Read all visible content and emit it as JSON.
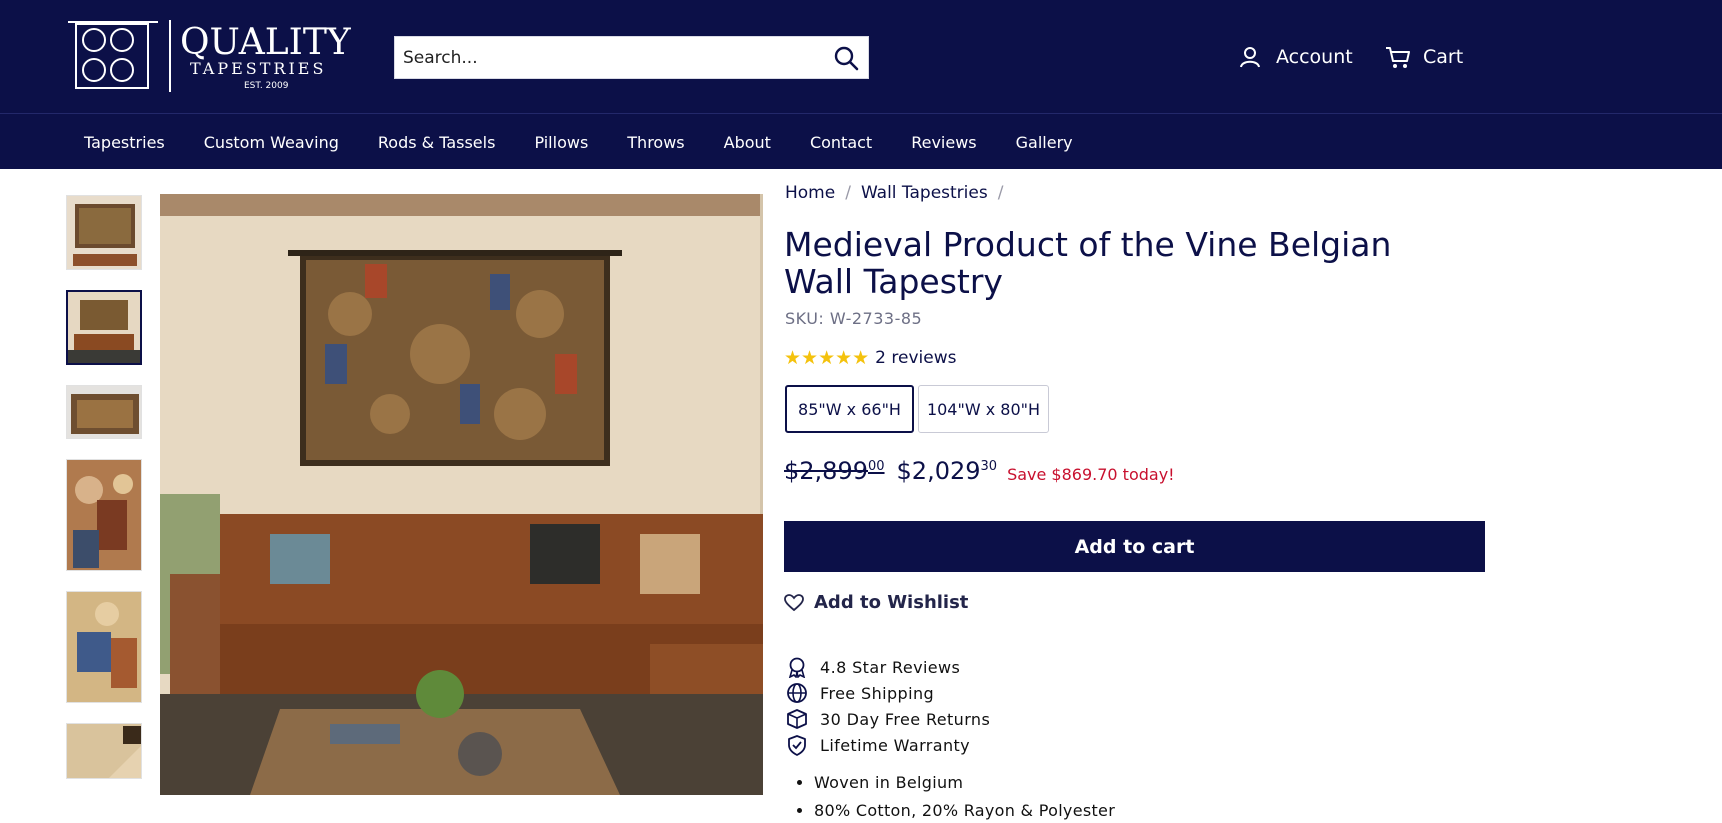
{
  "header": {
    "logo": {
      "name": "QUALITY",
      "sub": "TAPESTRIES",
      "est": "EST. 2009"
    },
    "search_placeholder": "Search...",
    "account_label": "Account",
    "cart_label": "Cart"
  },
  "nav": {
    "items": [
      "Tapestries",
      "Custom Weaving",
      "Rods & Tassels",
      "Pillows",
      "Throws",
      "About",
      "Contact",
      "Reviews",
      "Gallery"
    ]
  },
  "breadcrumb": {
    "home": "Home",
    "category": "Wall Tapestries"
  },
  "product": {
    "title": "Medieval Product of the Vine Belgian Wall Tapestry",
    "sku": "SKU: W-2733-85",
    "reviews_label": "2 reviews",
    "stars": "★★★★★",
    "variants": [
      "85\"W x 66\"H",
      "104\"W x 80\"H"
    ],
    "selected_variant": "85\"W x 66\"H",
    "old_price_main": "$2,899",
    "old_price_cents": "00",
    "price_main": "$2,029",
    "price_cents": "30",
    "save_text": "Save $869.70 today!",
    "add_to_cart": "Add to cart",
    "wishlist": "Add to Wishlist"
  },
  "features": [
    "4.8 Star Reviews",
    "Free Shipping",
    "30 Day Free Returns",
    "Lifetime Warranty"
  ],
  "bullets": [
    "Woven in Belgium",
    "80% Cotton, 20% Rayon & Polyester"
  ],
  "colors": {
    "brand": "#0c1048",
    "save": "#c8102e",
    "star": "#f4c20d"
  }
}
